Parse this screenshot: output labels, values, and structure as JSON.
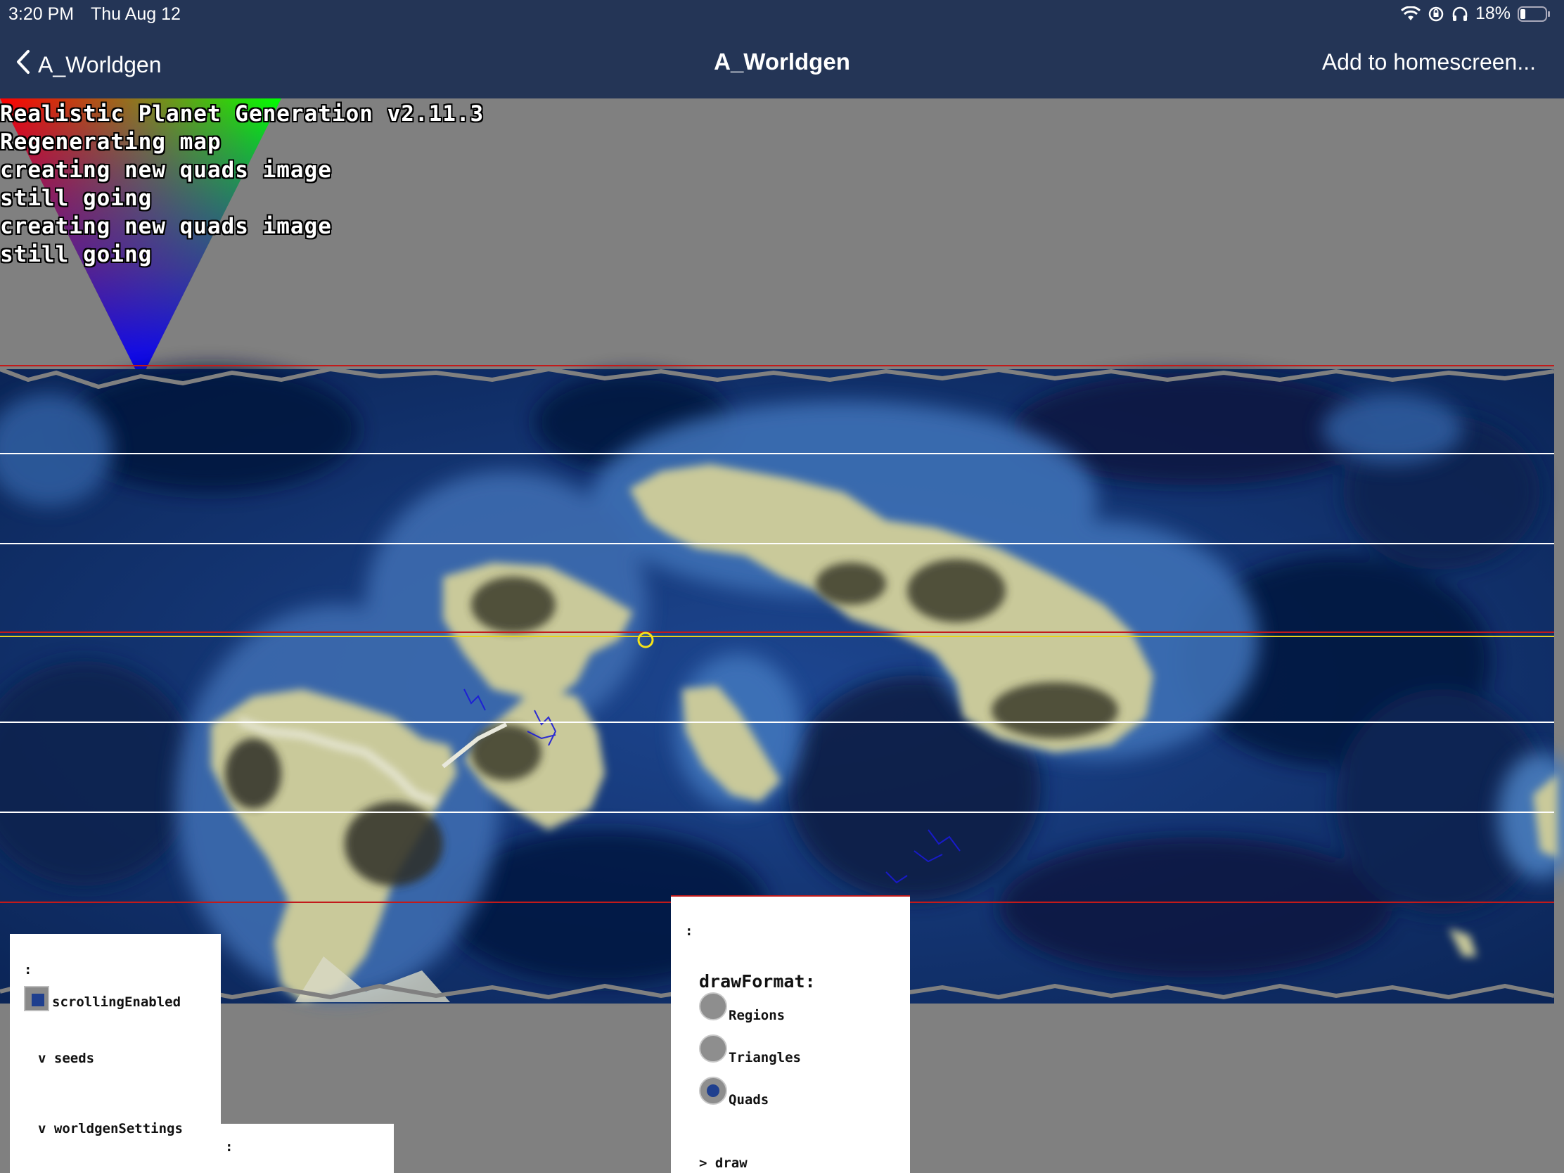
{
  "status_bar": {
    "time": "3:20 PM",
    "date": "Thu Aug 12",
    "battery": "18%",
    "icons": [
      "wifi-icon",
      "orientation-lock-icon",
      "headphones-icon",
      "battery-icon"
    ]
  },
  "nav": {
    "back_label": "A_Worldgen",
    "title": "A_Worldgen",
    "add_homescreen": "Add to homescreen..."
  },
  "log": [
    "Realistic Planet Generation v2.11.3",
    "Regenerating map",
    "creating new quads image",
    "still going",
    "creating new quads image",
    "still going"
  ],
  "settings_panel": {
    "handle": ":",
    "scrolling_enabled_label": "scrollingEnabled",
    "scrolling_enabled": true,
    "seeds_label": "v seeds",
    "worldgen_label": "v worldgenSettings"
  },
  "subpanel": {
    "handle": ":"
  },
  "draw_panel": {
    "handle": ":",
    "title": "drawFormat:",
    "options": [
      "Regions",
      "Triangles",
      "Quads"
    ],
    "selected": "Quads",
    "draw_label": "> draw"
  },
  "colors": {
    "bar": "#243556",
    "canvas": "#808080",
    "ocean_deep": "#0b2557",
    "ocean_shallow": "#3f6fb0",
    "land": "#c9c99a",
    "selected": "#1f3f8e"
  }
}
